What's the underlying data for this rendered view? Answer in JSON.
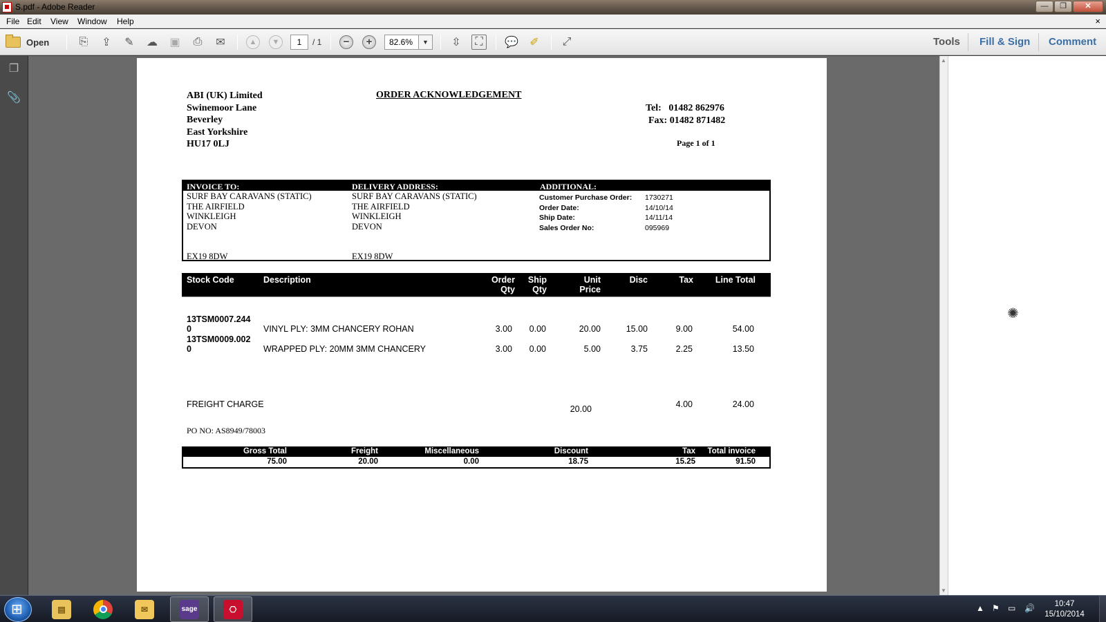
{
  "window": {
    "title": "S.pdf - Adobe Reader",
    "min_label": "—",
    "max_label": "❐",
    "close_label": "✕"
  },
  "menu": {
    "items": [
      "File",
      "Edit",
      "View",
      "Window",
      "Help"
    ],
    "doc_close": "×"
  },
  "toolbar": {
    "open_label": "Open",
    "page_current": "1",
    "page_total": "/ 1",
    "zoom": "82.6%",
    "tools_label": "Tools",
    "fill_sign_label": "Fill & Sign",
    "comment_label": "Comment"
  },
  "document": {
    "company": {
      "name": "ABI (UK) Limited",
      "line1": "Swinemoor Lane",
      "line2": "Beverley",
      "line3": "East Yorkshire",
      "postcode": "HU17 0LJ"
    },
    "title": "ORDER ACKNOWLEDGEMENT",
    "tel": "Tel:   01482 862976",
    "fax": "Fax: 01482 871482",
    "page_of": "Page 1 of 1",
    "addresses": {
      "invoice_head": "INVOICE TO:",
      "delivery_head": "DELIVERY ADDRESS:",
      "additional_head": "ADDITIONAL:",
      "invoice": [
        "SURF BAY CARAVANS (STATIC)",
        "THE AIRFIELD",
        "WINKLEIGH",
        "DEVON"
      ],
      "invoice_postcode": "EX19 8DW",
      "delivery": [
        "SURF BAY CARAVANS (STATIC)",
        "THE AIRFIELD",
        "WINKLEIGH",
        "DEVON"
      ],
      "delivery_postcode": "EX19 8DW",
      "additional_labels": [
        "Customer Purchase Order:",
        "Order Date:",
        "Ship Date:",
        "Sales Order No:"
      ],
      "additional_values": [
        "1730271",
        "14/10/14",
        "14/11/14",
        "095969"
      ]
    },
    "items_header": {
      "stock_code": "Stock Code",
      "description": "Description",
      "order_qty_1": "Order",
      "order_qty_2": "Qty",
      "ship_qty_1": "Ship",
      "ship_qty_2": "Qty",
      "unit_price_1": "Unit",
      "unit_price_2": "Price",
      "disc": "Disc",
      "tax": "Tax",
      "line_total": "Line Total"
    },
    "items": [
      {
        "code_1": "13TSM0007.244",
        "code_2": "0",
        "description": "VINYL PLY: 3MM CHANCERY ROHAN",
        "order_qty": "3.00",
        "ship_qty": "0.00",
        "unit_price": "20.00",
        "disc": "15.00",
        "tax": "9.00",
        "line_total": "54.00"
      },
      {
        "code_1": "13TSM0009.002",
        "code_2": "0",
        "description": "WRAPPED PLY: 20MM 3MM CHANCERY",
        "order_qty": "3.00",
        "ship_qty": "0.00",
        "unit_price": "5.00",
        "disc": "3.75",
        "tax": "2.25",
        "line_total": "13.50"
      }
    ],
    "freight": {
      "label": "FREIGHT CHARGE",
      "unit_price": "20.00",
      "tax": "4.00",
      "line_total": "24.00"
    },
    "po_no": "PO NO: AS8949/78003",
    "totals_header": {
      "gross": "Gross Total",
      "freight": "Freight",
      "misc": "Miscellaneous",
      "discount": "Discount",
      "tax": "Tax",
      "total": "Total invoice"
    },
    "totals": {
      "gross": "75.00",
      "freight": "20.00",
      "misc": "0.00",
      "discount": "18.75",
      "tax": "15.25",
      "total": "91.50"
    }
  },
  "taskbar": {
    "time": "10:47",
    "date": "15/10/2014",
    "sage_label": "sage"
  }
}
